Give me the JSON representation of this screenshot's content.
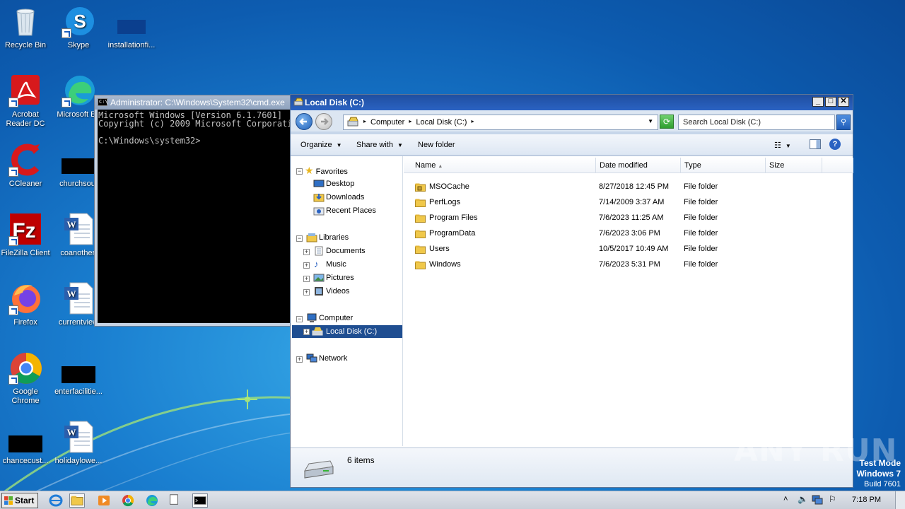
{
  "desktop": {
    "icons": [
      {
        "name": "recycle-bin",
        "label": "Recycle Bin"
      },
      {
        "name": "skype",
        "label": "Skype"
      },
      {
        "name": "installationfile",
        "label": "installationfi..."
      },
      {
        "name": "acrobat",
        "label": "Acrobat Reader DC"
      },
      {
        "name": "microsoft-edge",
        "label": "Microsoft Ed"
      },
      {
        "name": "ccleaner",
        "label": "CCleaner"
      },
      {
        "name": "churchsout",
        "label": "churchsout"
      },
      {
        "name": "filezilla",
        "label": "FileZilla Client"
      },
      {
        "name": "coanother",
        "label": "coanother."
      },
      {
        "name": "firefox",
        "label": "Firefox"
      },
      {
        "name": "currentview",
        "label": "currentview"
      },
      {
        "name": "google-chrome",
        "label": "Google Chrome"
      },
      {
        "name": "enterfacilitie",
        "label": "enterfacilitie..."
      },
      {
        "name": "chancecust",
        "label": "chancecust..."
      },
      {
        "name": "holidaylowe",
        "label": "holidaylowe..."
      }
    ]
  },
  "cmd": {
    "title": "Administrator: C:\\Windows\\System32\\cmd.exe",
    "lines": [
      "Microsoft Windows [Version 6.1.7601]",
      "Copyright (c) 2009 Microsoft Corporation.",
      "",
      "C:\\Windows\\system32>"
    ]
  },
  "explorer": {
    "title": "Local Disk (C:)",
    "address": {
      "part1": "Computer",
      "part2": "Local Disk (C:)"
    },
    "search_placeholder": "Search Local Disk (C:)",
    "toolbar": {
      "organize": "Organize",
      "share_with": "Share with",
      "new_folder": "New folder"
    },
    "nav": {
      "favorites": "Favorites",
      "desktop": "Desktop",
      "downloads": "Downloads",
      "recent_places": "Recent Places",
      "libraries": "Libraries",
      "documents": "Documents",
      "music": "Music",
      "pictures": "Pictures",
      "videos": "Videos",
      "computer": "Computer",
      "local_disk": "Local Disk (C:)",
      "network": "Network"
    },
    "columns": {
      "name": "Name",
      "date": "Date modified",
      "type": "Type",
      "size": "Size"
    },
    "rows": [
      {
        "name": "MSOCache",
        "date": "8/27/2018 12:45 PM",
        "type": "File folder"
      },
      {
        "name": "PerfLogs",
        "date": "7/14/2009 3:37 AM",
        "type": "File folder"
      },
      {
        "name": "Program Files",
        "date": "7/6/2023 11:25 AM",
        "type": "File folder"
      },
      {
        "name": "ProgramData",
        "date": "7/6/2023 3:06 PM",
        "type": "File folder"
      },
      {
        "name": "Users",
        "date": "10/5/2017 10:49 AM",
        "type": "File folder"
      },
      {
        "name": "Windows",
        "date": "7/6/2023 5:31 PM",
        "type": "File folder"
      }
    ],
    "status": "6 items"
  },
  "watermark": "ANY RUN",
  "test_mode": {
    "line1": "Test Mode",
    "line2": "Windows 7",
    "line3": "Build 7601"
  },
  "taskbar": {
    "start": "Start",
    "clock": "7:18 PM"
  },
  "colors": {
    "title_active": "#1f4fa0",
    "selection": "#1f4e91",
    "desktop": "#1a7fd0"
  }
}
